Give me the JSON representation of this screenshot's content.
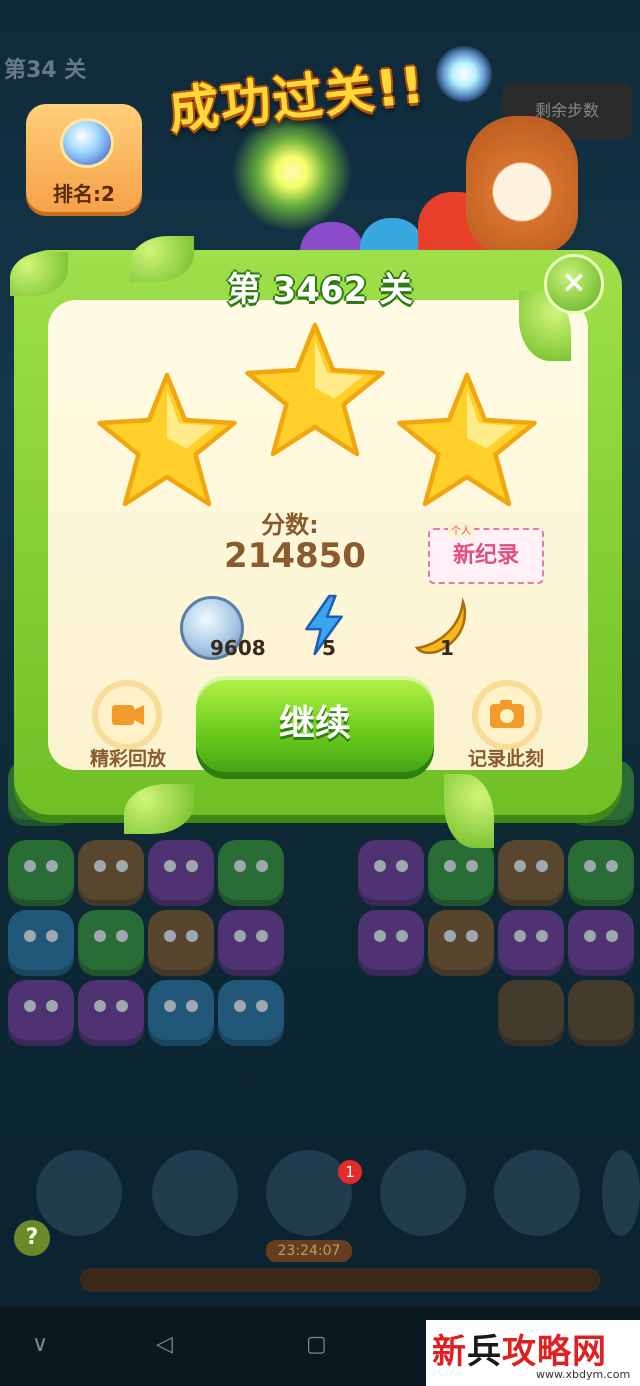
{
  "hud": {
    "level_text": "第34 关",
    "rank_label": "排名:2",
    "moves_label": "剩余步数",
    "title": "成功过关!!"
  },
  "panel": {
    "level_title": "第 3462 关",
    "close_label": "×",
    "stars_earned": 3,
    "score_label": "分数:",
    "score_value": "214850",
    "record_small": "个人",
    "record_label": "新纪录",
    "rewards": [
      {
        "icon": "coin-icon",
        "count": "9608"
      },
      {
        "icon": "lightning-icon",
        "count": "5"
      },
      {
        "icon": "banana-icon",
        "count": "1"
      }
    ],
    "replay_label": "精彩回放",
    "continue_label": "继续",
    "capture_label": "记录此刻"
  },
  "bottom": {
    "booster_badge": "1",
    "timer": "23:24:07",
    "help_label": "?"
  },
  "navbar": {
    "back": "◁",
    "home": "▢",
    "menu": "∨"
  },
  "watermark": {
    "brand_red": "新",
    "brand_black": "兵",
    "brand_rest": "攻略网",
    "url": "www.xbdym.com"
  },
  "colors": {
    "panel_green": "#6fbf25",
    "panel_cream": "#fffbe4",
    "score_brown": "#8a5b2c",
    "title_yellow": "#ffd93a",
    "record_pink": "#e05080"
  }
}
